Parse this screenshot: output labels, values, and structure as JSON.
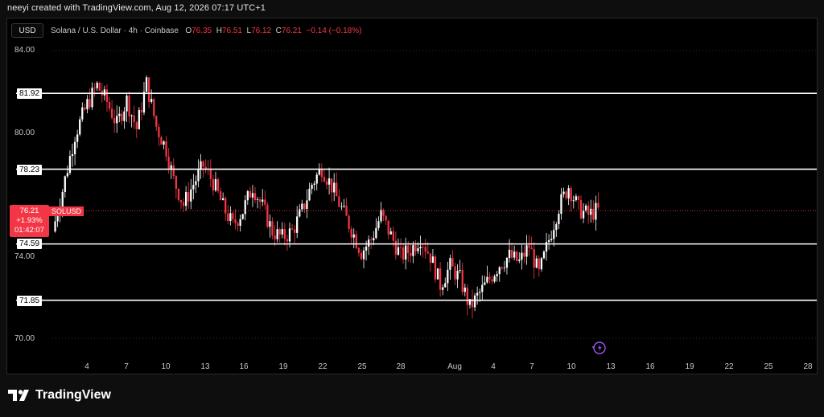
{
  "header": {
    "text": "neeyi created with TradingView.com, Aug 12, 2026 07:17 UTC+1"
  },
  "toolbar": {
    "currency": "USD",
    "symbol_desc": "Solana / U.S. Dollar · 4h · Coinbase",
    "ohlc": [
      {
        "k": "O",
        "v": "76.35"
      },
      {
        "k": "H",
        "v": "76.51"
      },
      {
        "k": "L",
        "v": "76.12"
      },
      {
        "k": "C",
        "v": "76.21"
      }
    ],
    "change": "−0.14 (−0.18%)"
  },
  "price_axis": {
    "labels": [
      "84.00",
      "80.00",
      "74.00",
      "70.00"
    ],
    "levels": [
      "81.92",
      "78.23",
      "74.59",
      "71.85"
    ]
  },
  "last_price": {
    "price": "76.21",
    "change_pct": "+1.93%",
    "countdown": "01:42:07",
    "symbol": "SOLUSD"
  },
  "x_axis": {
    "labels": [
      "4",
      "7",
      "10",
      "13",
      "16",
      "19",
      "22",
      "25",
      "28",
      "Aug",
      "4",
      "7",
      "10",
      "13",
      "16",
      "19",
      "22",
      "25",
      "28"
    ]
  },
  "colors": {
    "up": "#ffffff",
    "down": "#f23645",
    "level": "#ffffff",
    "background": "#000000"
  },
  "footer": {
    "brand": "TradingView"
  },
  "chart_data": {
    "type": "candlestick",
    "symbol": "SOLUSD",
    "interval": "4h",
    "ylim": [
      69.4,
      84.2
    ],
    "horizontal_levels": [
      81.92,
      78.23,
      74.59,
      71.85
    ],
    "price_path": [
      [
        0,
        75.2
      ],
      [
        4,
        77.2
      ],
      [
        9,
        79.9
      ],
      [
        14,
        81.4
      ],
      [
        18,
        82.3
      ],
      [
        22,
        81.5
      ],
      [
        26,
        80.4
      ],
      [
        30,
        81.6
      ],
      [
        34,
        80.2
      ],
      [
        38,
        82.4
      ],
      [
        42,
        80.3
      ],
      [
        46,
        79.2
      ],
      [
        49,
        77.7
      ],
      [
        53,
        76.5
      ],
      [
        57,
        77.5
      ],
      [
        61,
        78.4
      ],
      [
        65,
        77.6
      ],
      [
        69,
        76.4
      ],
      [
        73,
        75.5
      ],
      [
        77,
        76.2
      ],
      [
        81,
        77.4
      ],
      [
        85,
        76.4
      ],
      [
        89,
        75.2
      ],
      [
        93,
        74.9
      ],
      [
        97,
        75.2
      ],
      [
        101,
        76.2
      ],
      [
        105,
        77.5
      ],
      [
        109,
        78.3
      ],
      [
        113,
        77.4
      ],
      [
        117,
        76.3
      ],
      [
        121,
        75.3
      ],
      [
        125,
        74.2
      ],
      [
        129,
        74.8
      ],
      [
        133,
        76.0
      ],
      [
        137,
        75.0
      ],
      [
        141,
        74.0
      ],
      [
        145,
        74.3
      ],
      [
        149,
        74.9
      ],
      [
        153,
        74.0
      ],
      [
        157,
        72.6
      ],
      [
        161,
        73.5
      ],
      [
        165,
        72.9
      ],
      [
        169,
        71.5
      ],
      [
        173,
        72.2
      ],
      [
        177,
        72.9
      ],
      [
        181,
        73.6
      ],
      [
        185,
        74.0
      ],
      [
        189,
        73.7
      ],
      [
        193,
        74.5
      ],
      [
        197,
        73.1
      ],
      [
        201,
        74.8
      ],
      [
        205,
        76.4
      ],
      [
        209,
        77.4
      ],
      [
        213,
        76.3
      ],
      [
        217,
        76.0
      ],
      [
        220,
        76.2
      ]
    ]
  }
}
